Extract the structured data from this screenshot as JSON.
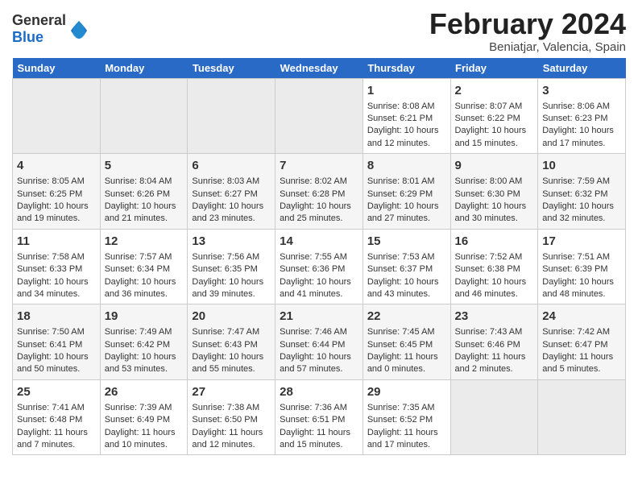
{
  "header": {
    "logo_general": "General",
    "logo_blue": "Blue",
    "title": "February 2024",
    "subtitle": "Beniatjar, Valencia, Spain"
  },
  "calendar": {
    "days_of_week": [
      "Sunday",
      "Monday",
      "Tuesday",
      "Wednesday",
      "Thursday",
      "Friday",
      "Saturday"
    ],
    "weeks": [
      [
        {
          "day": "",
          "content": "",
          "empty": true
        },
        {
          "day": "",
          "content": "",
          "empty": true
        },
        {
          "day": "",
          "content": "",
          "empty": true
        },
        {
          "day": "",
          "content": "",
          "empty": true
        },
        {
          "day": "1",
          "content": "Sunrise: 8:08 AM\nSunset: 6:21 PM\nDaylight: 10 hours\nand 12 minutes.",
          "empty": false
        },
        {
          "day": "2",
          "content": "Sunrise: 8:07 AM\nSunset: 6:22 PM\nDaylight: 10 hours\nand 15 minutes.",
          "empty": false
        },
        {
          "day": "3",
          "content": "Sunrise: 8:06 AM\nSunset: 6:23 PM\nDaylight: 10 hours\nand 17 minutes.",
          "empty": false
        }
      ],
      [
        {
          "day": "4",
          "content": "Sunrise: 8:05 AM\nSunset: 6:25 PM\nDaylight: 10 hours\nand 19 minutes.",
          "empty": false
        },
        {
          "day": "5",
          "content": "Sunrise: 8:04 AM\nSunset: 6:26 PM\nDaylight: 10 hours\nand 21 minutes.",
          "empty": false
        },
        {
          "day": "6",
          "content": "Sunrise: 8:03 AM\nSunset: 6:27 PM\nDaylight: 10 hours\nand 23 minutes.",
          "empty": false
        },
        {
          "day": "7",
          "content": "Sunrise: 8:02 AM\nSunset: 6:28 PM\nDaylight: 10 hours\nand 25 minutes.",
          "empty": false
        },
        {
          "day": "8",
          "content": "Sunrise: 8:01 AM\nSunset: 6:29 PM\nDaylight: 10 hours\nand 27 minutes.",
          "empty": false
        },
        {
          "day": "9",
          "content": "Sunrise: 8:00 AM\nSunset: 6:30 PM\nDaylight: 10 hours\nand 30 minutes.",
          "empty": false
        },
        {
          "day": "10",
          "content": "Sunrise: 7:59 AM\nSunset: 6:32 PM\nDaylight: 10 hours\nand 32 minutes.",
          "empty": false
        }
      ],
      [
        {
          "day": "11",
          "content": "Sunrise: 7:58 AM\nSunset: 6:33 PM\nDaylight: 10 hours\nand 34 minutes.",
          "empty": false
        },
        {
          "day": "12",
          "content": "Sunrise: 7:57 AM\nSunset: 6:34 PM\nDaylight: 10 hours\nand 36 minutes.",
          "empty": false
        },
        {
          "day": "13",
          "content": "Sunrise: 7:56 AM\nSunset: 6:35 PM\nDaylight: 10 hours\nand 39 minutes.",
          "empty": false
        },
        {
          "day": "14",
          "content": "Sunrise: 7:55 AM\nSunset: 6:36 PM\nDaylight: 10 hours\nand 41 minutes.",
          "empty": false
        },
        {
          "day": "15",
          "content": "Sunrise: 7:53 AM\nSunset: 6:37 PM\nDaylight: 10 hours\nand 43 minutes.",
          "empty": false
        },
        {
          "day": "16",
          "content": "Sunrise: 7:52 AM\nSunset: 6:38 PM\nDaylight: 10 hours\nand 46 minutes.",
          "empty": false
        },
        {
          "day": "17",
          "content": "Sunrise: 7:51 AM\nSunset: 6:39 PM\nDaylight: 10 hours\nand 48 minutes.",
          "empty": false
        }
      ],
      [
        {
          "day": "18",
          "content": "Sunrise: 7:50 AM\nSunset: 6:41 PM\nDaylight: 10 hours\nand 50 minutes.",
          "empty": false
        },
        {
          "day": "19",
          "content": "Sunrise: 7:49 AM\nSunset: 6:42 PM\nDaylight: 10 hours\nand 53 minutes.",
          "empty": false
        },
        {
          "day": "20",
          "content": "Sunrise: 7:47 AM\nSunset: 6:43 PM\nDaylight: 10 hours\nand 55 minutes.",
          "empty": false
        },
        {
          "day": "21",
          "content": "Sunrise: 7:46 AM\nSunset: 6:44 PM\nDaylight: 10 hours\nand 57 minutes.",
          "empty": false
        },
        {
          "day": "22",
          "content": "Sunrise: 7:45 AM\nSunset: 6:45 PM\nDaylight: 11 hours\nand 0 minutes.",
          "empty": false
        },
        {
          "day": "23",
          "content": "Sunrise: 7:43 AM\nSunset: 6:46 PM\nDaylight: 11 hours\nand 2 minutes.",
          "empty": false
        },
        {
          "day": "24",
          "content": "Sunrise: 7:42 AM\nSunset: 6:47 PM\nDaylight: 11 hours\nand 5 minutes.",
          "empty": false
        }
      ],
      [
        {
          "day": "25",
          "content": "Sunrise: 7:41 AM\nSunset: 6:48 PM\nDaylight: 11 hours\nand 7 minutes.",
          "empty": false
        },
        {
          "day": "26",
          "content": "Sunrise: 7:39 AM\nSunset: 6:49 PM\nDaylight: 11 hours\nand 10 minutes.",
          "empty": false
        },
        {
          "day": "27",
          "content": "Sunrise: 7:38 AM\nSunset: 6:50 PM\nDaylight: 11 hours\nand 12 minutes.",
          "empty": false
        },
        {
          "day": "28",
          "content": "Sunrise: 7:36 AM\nSunset: 6:51 PM\nDaylight: 11 hours\nand 15 minutes.",
          "empty": false
        },
        {
          "day": "29",
          "content": "Sunrise: 7:35 AM\nSunset: 6:52 PM\nDaylight: 11 hours\nand 17 minutes.",
          "empty": false
        },
        {
          "day": "",
          "content": "",
          "empty": true
        },
        {
          "day": "",
          "content": "",
          "empty": true
        }
      ]
    ]
  }
}
